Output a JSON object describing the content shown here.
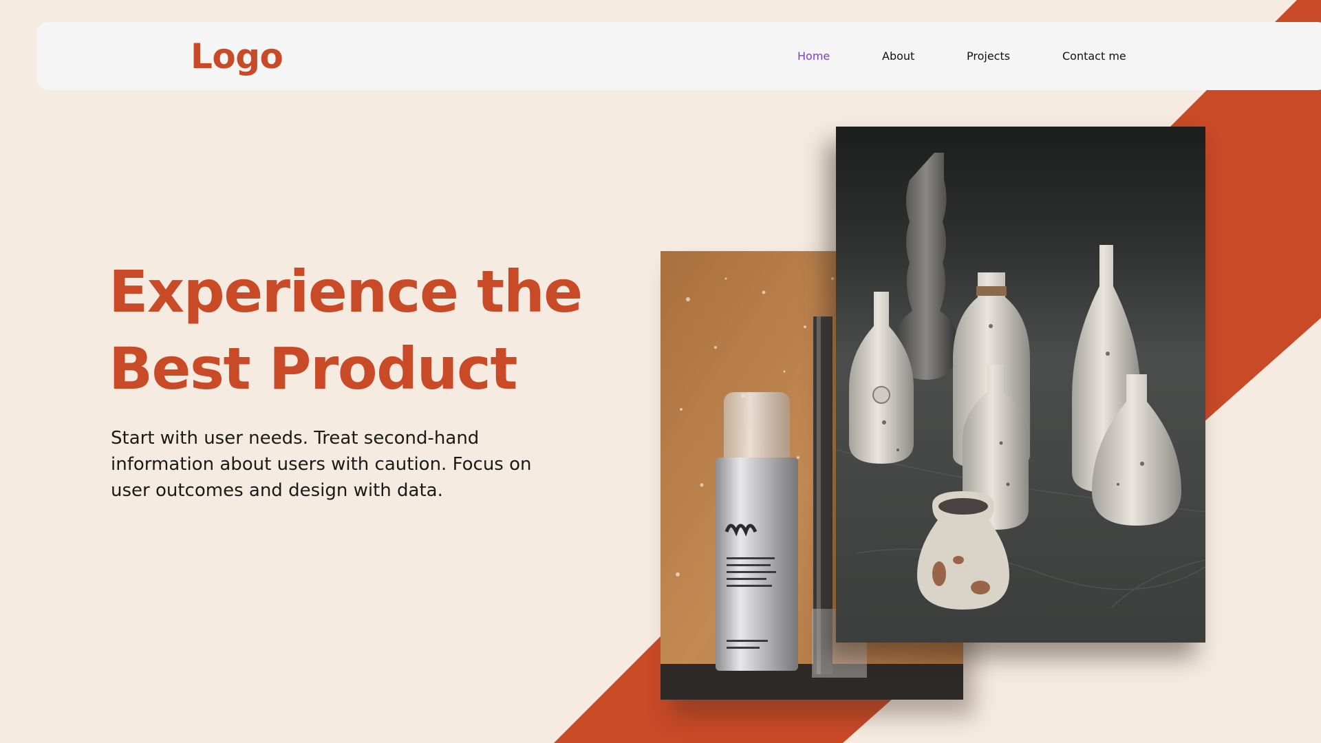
{
  "header": {
    "logo": "Logo",
    "nav": [
      {
        "label": "Home"
      },
      {
        "label": "About"
      },
      {
        "label": "Projects"
      },
      {
        "label": "Contact me"
      }
    ]
  },
  "hero": {
    "title_line_1": "Experience the",
    "title_line_2": "Best Product",
    "description": "Start with user needs. Treat second-hand information about users with caution. Focus on user outcomes and design with data."
  },
  "colors": {
    "background": "#f5ebe1",
    "accent": "#c94a27",
    "nav_active": "#7b3fc4",
    "navbar_bg": "#f5f5f5"
  }
}
